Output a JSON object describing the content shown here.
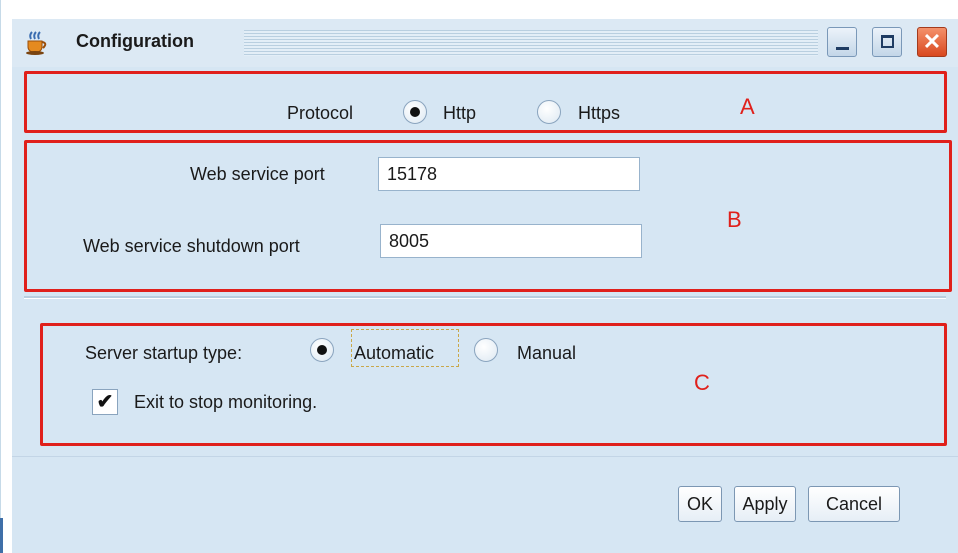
{
  "window": {
    "title": "Configuration",
    "close_glyph": "✕"
  },
  "protocol": {
    "label": "Protocol",
    "options": [
      {
        "label": "Http",
        "selected": true
      },
      {
        "label": "Https",
        "selected": false
      }
    ]
  },
  "ports": {
    "web_service_port_label": "Web service port",
    "web_service_port_value": "15178",
    "shutdown_port_label": "Web service shutdown port",
    "shutdown_port_value": "8005"
  },
  "startup": {
    "label": "Server startup type:",
    "options": [
      {
        "label": "Automatic",
        "selected": true
      },
      {
        "label": "Manual",
        "selected": false
      }
    ],
    "exit_checkbox_label": "Exit to stop monitoring.",
    "exit_checkbox_checked": true,
    "check_glyph": "✔"
  },
  "annotations": {
    "a": "A",
    "b": "B",
    "c": "C"
  },
  "buttons": {
    "ok": "OK",
    "apply": "Apply",
    "cancel": "Cancel"
  },
  "colors": {
    "annotation_red": "#e0201b",
    "window_bg": "#d6e6f3"
  },
  "icons": {
    "app": "coffee-cup-icon",
    "minimize": "minimize-icon",
    "maximize": "maximize-icon",
    "close": "close-icon"
  }
}
